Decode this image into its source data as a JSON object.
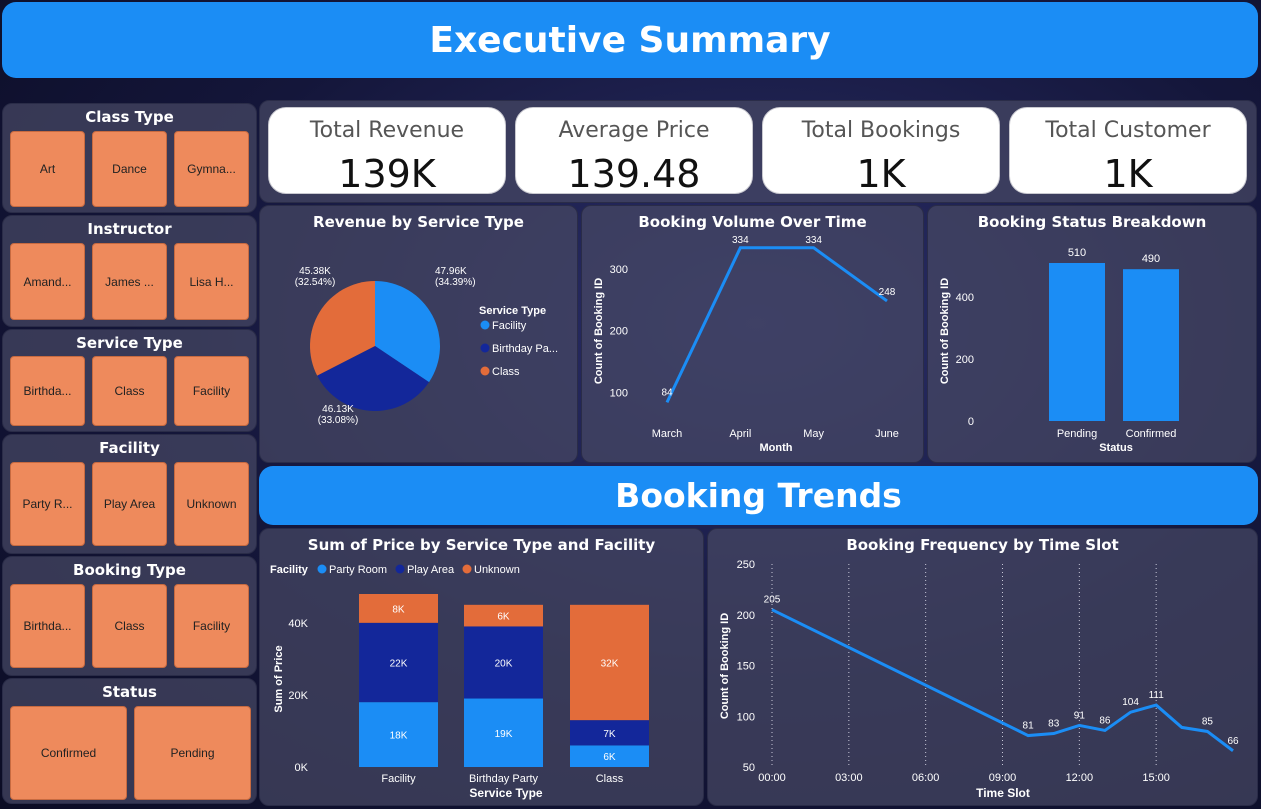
{
  "header": {
    "title": "Executive Summary"
  },
  "section2": {
    "title": "Booking Trends"
  },
  "slicers": [
    {
      "title": "Class Type",
      "items": [
        "Art",
        "Dance",
        "Gymna..."
      ]
    },
    {
      "title": "Instructor",
      "items": [
        "Amand...",
        "James ...",
        "Lisa H..."
      ]
    },
    {
      "title": "Service Type",
      "items": [
        "Birthda...",
        "Class",
        "Facility"
      ]
    },
    {
      "title": "Facility",
      "items": [
        "Party R...",
        "Play Area",
        "Unknown"
      ]
    },
    {
      "title": "Booking Type",
      "items": [
        "Birthda...",
        "Class",
        "Facility"
      ]
    },
    {
      "title": "Status",
      "items": [
        "Confirmed",
        "Pending"
      ]
    }
  ],
  "kpis": [
    {
      "label": "Total Revenue",
      "value": "139K"
    },
    {
      "label": "Average Price",
      "value": "139.48"
    },
    {
      "label": "Total Bookings",
      "value": "1K"
    },
    {
      "label": "Total Customer",
      "value": "1K"
    }
  ],
  "colors": {
    "accent": "#1b8df5",
    "facility": "#1b8df5",
    "birthday_party": "#13279a",
    "class": "#e36c3a",
    "party_room": "#1b8df5",
    "play_area": "#13279a",
    "unknown": "#e36c3a",
    "slicer_tile": "#ee8a5c"
  },
  "chart_data": [
    {
      "id": "revenue_by_service",
      "type": "pie",
      "title": "Revenue by Service Type",
      "legend_title": "Service Type",
      "slices": [
        {
          "name": "Facility",
          "value": 47.96,
          "label": "47.96K",
          "pct": "(34.39%)"
        },
        {
          "name": "Birthday Pa...",
          "value": 46.13,
          "label": "46.13K",
          "pct": "(33.08%)"
        },
        {
          "name": "Class",
          "value": 45.38,
          "label": "45.38K",
          "pct": "(32.54%)"
        }
      ]
    },
    {
      "id": "booking_volume",
      "type": "line",
      "title": "Booking Volume Over Time",
      "xlabel": "Month",
      "ylabel": "Count of Booking ID",
      "categories": [
        "March",
        "April",
        "May",
        "June"
      ],
      "values": [
        84,
        334,
        334,
        248
      ],
      "yticks": [
        100,
        200,
        300
      ],
      "ylim": [
        70,
        345
      ]
    },
    {
      "id": "booking_status",
      "type": "bar",
      "title": "Booking Status Breakdown",
      "xlabel": "Status",
      "ylabel": "Count of Booking ID",
      "categories": [
        "Pending",
        "Confirmed"
      ],
      "values": [
        510,
        490
      ],
      "yticks": [
        0,
        200,
        400
      ],
      "ylim": [
        0,
        510
      ]
    },
    {
      "id": "price_by_service_facility",
      "type": "bar",
      "stacked": true,
      "title": "Sum of Price by Service Type and Facility",
      "xlabel": "Service Type",
      "ylabel": "Sum of Price",
      "legend_title": "Facility",
      "categories": [
        "Facility",
        "Birthday Party",
        "Class"
      ],
      "series": [
        {
          "name": "Party Room",
          "values": [
            18,
            19,
            6
          ],
          "labels": [
            "18K",
            "19K",
            "6K"
          ]
        },
        {
          "name": "Play Area",
          "values": [
            22,
            20,
            7
          ],
          "labels": [
            "22K",
            "20K",
            "7K"
          ]
        },
        {
          "name": "Unknown",
          "values": [
            8,
            6,
            32
          ],
          "labels": [
            "8K",
            "6K",
            "32K"
          ]
        }
      ],
      "yticks": [
        0,
        20,
        40
      ],
      "ytick_labels": [
        "0K",
        "20K",
        "40K"
      ],
      "ylim": [
        0,
        48
      ]
    },
    {
      "id": "booking_frequency",
      "type": "line",
      "title": "Booking Frequency by Time Slot",
      "xlabel": "Time Slot",
      "ylabel": "Count of Booking ID",
      "x": [
        0,
        10,
        11,
        12,
        13,
        14,
        15,
        16,
        17,
        18
      ],
      "values": [
        205,
        81,
        83,
        91,
        86,
        104,
        111,
        89,
        85,
        66
      ],
      "point_labels": [
        "205",
        "81",
        "83",
        "91",
        "86",
        "104",
        "111",
        "",
        "85",
        "66"
      ],
      "xticks": [
        0,
        3,
        6,
        9,
        12,
        15
      ],
      "xtick_labels": [
        "00:00",
        "03:00",
        "06:00",
        "09:00",
        "12:00",
        "15:00"
      ],
      "xlim": [
        0,
        18
      ],
      "yticks": [
        50,
        100,
        150,
        200,
        250
      ],
      "ylim": [
        50,
        250
      ]
    }
  ]
}
